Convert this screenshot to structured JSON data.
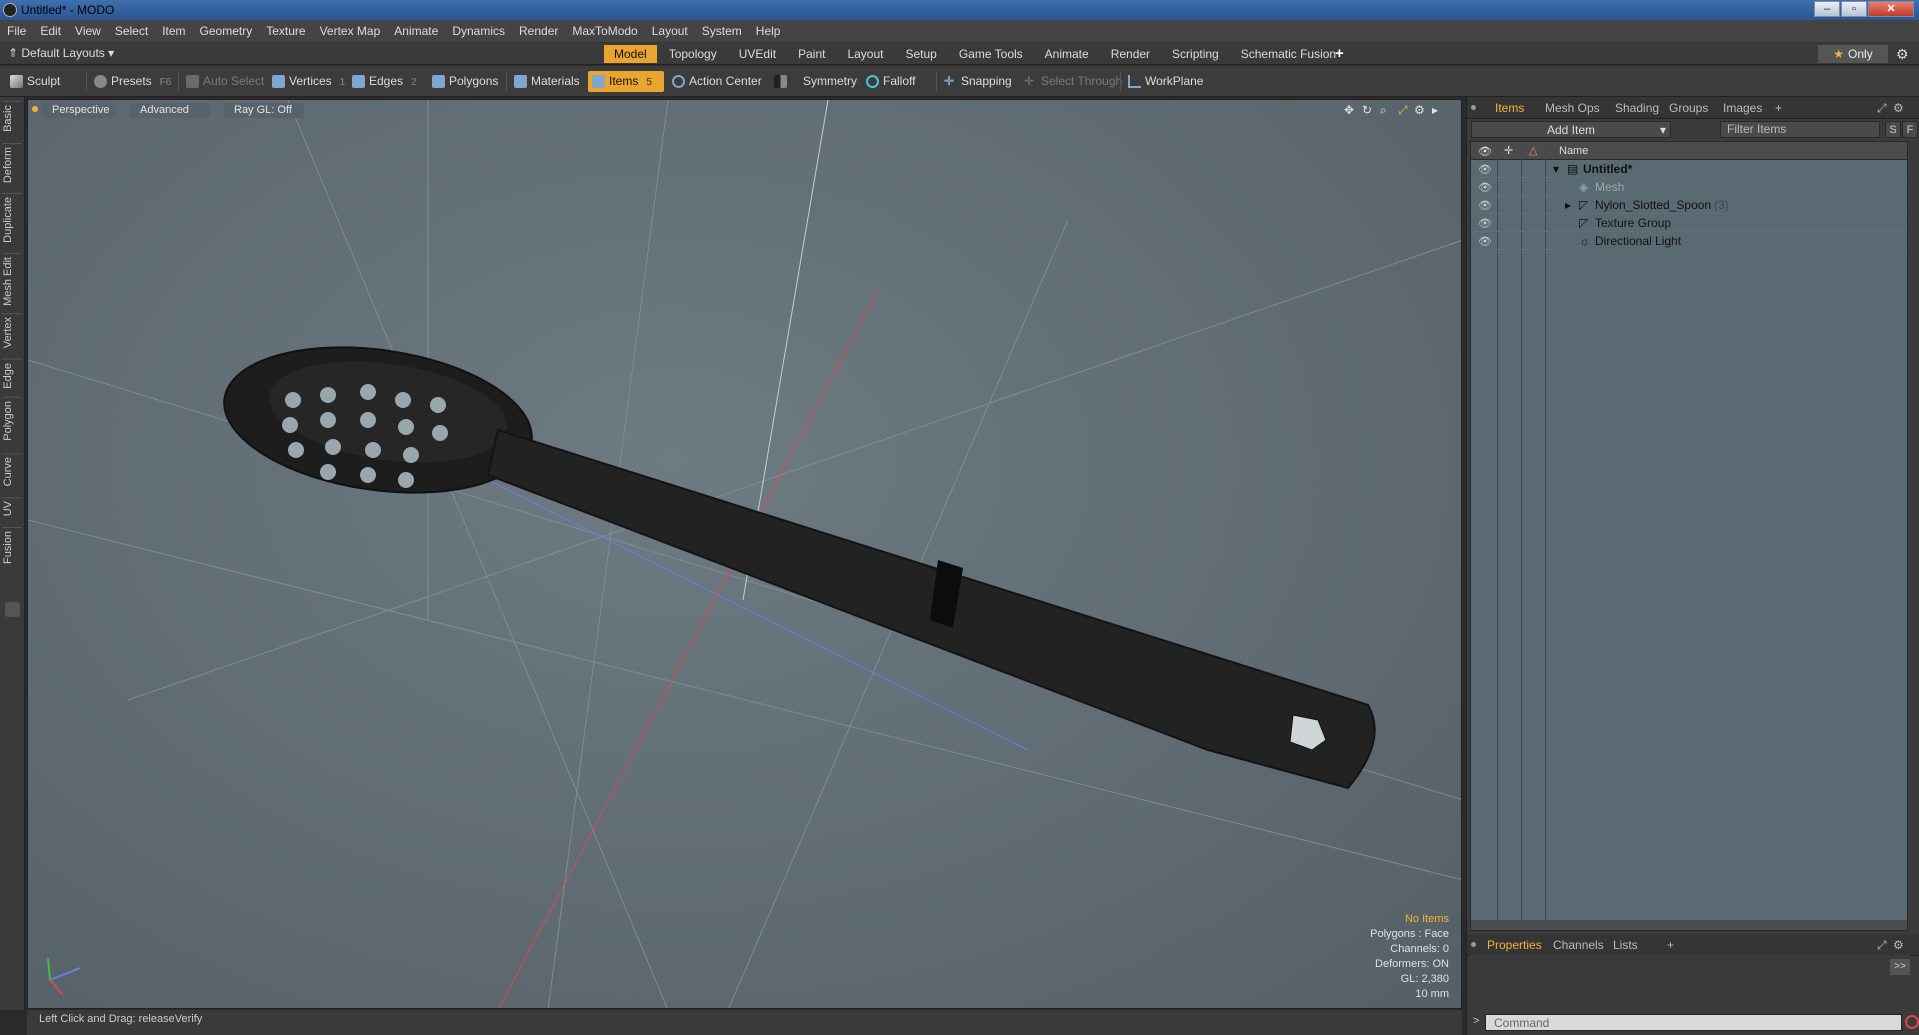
{
  "window": {
    "title": "Untitled* - MODO"
  },
  "menu": [
    "File",
    "Edit",
    "View",
    "Select",
    "Item",
    "Geometry",
    "Texture",
    "Vertex Map",
    "Animate",
    "Dynamics",
    "Render",
    "MaxToModo",
    "Layout",
    "System",
    "Help"
  ],
  "layout": {
    "preset": "Default Layouts ▾",
    "tabs": [
      "Model",
      "Topology",
      "UVEdit",
      "Paint",
      "Layout",
      "Setup",
      "Game Tools",
      "Animate",
      "Render",
      "Scripting",
      "Schematic Fusion"
    ],
    "active_tab": "Model",
    "plus": "+",
    "only_label": "Only"
  },
  "toolbar": {
    "sculpt": "Sculpt",
    "presets": "Presets",
    "presets_key": "F6",
    "auto_select": "Auto Select",
    "vertices": "Vertices",
    "vertices_key": "1",
    "edges": "Edges",
    "edges_key": "2",
    "polygons": "Polygons",
    "materials": "Materials",
    "items": "Items",
    "items_key": "5",
    "action_center": "Action Center",
    "symmetry": "Symmetry",
    "falloff": "Falloff",
    "snapping": "Snapping",
    "select_through": "Select Through",
    "workplane": "WorkPlane"
  },
  "left_tabs": [
    "Basic",
    "Deform",
    "Duplicate",
    "Mesh Edit",
    "Vertex",
    "Edge",
    "Polygon",
    "Curve",
    "UV",
    "Fusion"
  ],
  "viewport": {
    "perspective": "Perspective",
    "advanced": "Advanced",
    "raygl": "Ray GL: Off",
    "info": {
      "no_items": "No Items",
      "polygons": "Polygons : Face",
      "channels": "Channels: 0",
      "deformers": "Deformers: ON",
      "gl": "GL: 2,380",
      "scale": "10 mm"
    }
  },
  "status": {
    "text": "Left Click and Drag:  releaseVerify"
  },
  "panel": {
    "tabs": [
      "Items",
      "Mesh Ops",
      "Shading",
      "Groups",
      "Images"
    ],
    "active_tab": "Items",
    "plus": "+",
    "add_item": "Add Item",
    "filter_placeholder": "Filter Items",
    "s_btn": "S",
    "f_btn": "F",
    "name_col": "Name",
    "tree": [
      {
        "label": "Untitled*",
        "level": 0
      },
      {
        "label": "Mesh",
        "level": 1
      },
      {
        "label": "Nylon_Slotted_Spoon",
        "suffix": "(3)",
        "level": 1
      },
      {
        "label": "Texture Group",
        "level": 1
      },
      {
        "label": "Directional Light",
        "level": 1
      }
    ],
    "bottom_tabs": [
      "Properties",
      "Channels",
      "Lists"
    ],
    "bottom_active": "Properties",
    "expand": ">>",
    "command_placeholder": "Command",
    "prompt": ">"
  },
  "colors": {
    "accent": "#e9a52e",
    "viewport_bg": "#66737b",
    "title_bar": "#2a5592"
  }
}
